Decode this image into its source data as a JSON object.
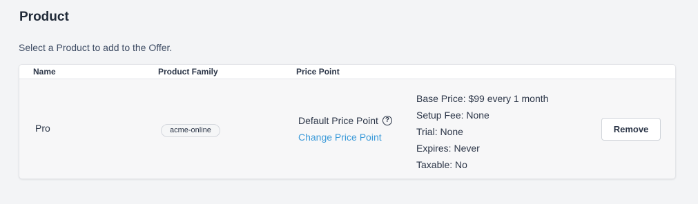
{
  "section": {
    "title": "Product",
    "subtitle": "Select a Product to add to the Offer."
  },
  "table": {
    "columns": [
      "Name",
      "Product Family",
      "Price Point"
    ],
    "rows": [
      {
        "name": "Pro",
        "product_family": "acme-online",
        "price_point": {
          "label": "Default Price Point",
          "help_icon": "question-circle-icon",
          "change_link": "Change Price Point"
        },
        "details": [
          "Base Price: $99 every 1 month",
          "Setup Fee: None",
          "Trial: None",
          "Expires: Never",
          "Taxable: No"
        ],
        "remove_label": "Remove"
      }
    ]
  },
  "colors": {
    "background": "#f3f4f6",
    "link": "#3b9ad9",
    "text": "#2b3547"
  }
}
